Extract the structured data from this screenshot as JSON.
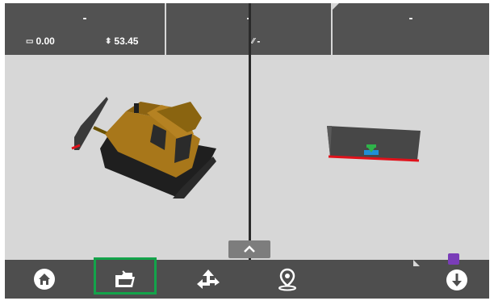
{
  "top": {
    "panel1_value": "-",
    "panel2_value": "-",
    "panel3_value": "-",
    "metric_left": "0.00",
    "metric_right": "53.45",
    "metric_slope": "-"
  },
  "icons": {
    "metric_left": "blade-width-icon",
    "metric_right": "elevation-icon",
    "metric_slope": "slope-icon",
    "home": "home-icon",
    "folder": "open-folder-icon",
    "guidance": "guidance-arrows-icon",
    "location": "location-pin-icon",
    "download": "download-icon",
    "up": "chevron-up-icon"
  },
  "colors": {
    "topbar": "#525252",
    "bottombar": "#4e4e4e",
    "viewport": "#d7d7d7",
    "divider": "#2a2a2a",
    "highlight": "#13a34a",
    "badge": "#7a3db8",
    "blade_edge": "#e0121b",
    "dozer_body": "#a8771a"
  }
}
